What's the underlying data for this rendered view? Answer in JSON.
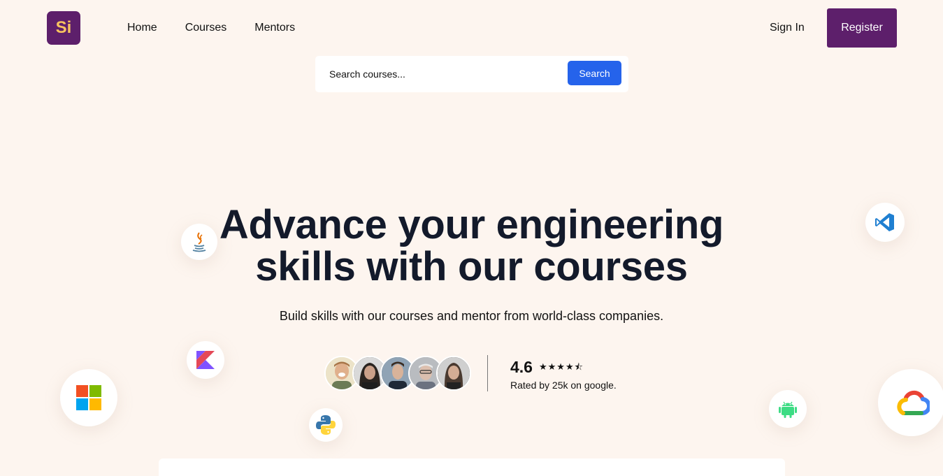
{
  "brand": {
    "logo_text": "Si",
    "logo_bg": "#5d1f6b",
    "logo_fg": "#f7c35f"
  },
  "nav": {
    "items": [
      {
        "label": "Home"
      },
      {
        "label": "Courses"
      },
      {
        "label": "Mentors"
      }
    ]
  },
  "auth": {
    "signin_label": "Sign In",
    "register_label": "Register"
  },
  "search": {
    "placeholder": "Search courses...",
    "button_label": "Search"
  },
  "hero": {
    "title_line1": "Advance your engineering",
    "title_line2": "skills with our courses",
    "subtitle": "Build skills with our courses and mentor from world-class companies."
  },
  "rating": {
    "score": "4.6",
    "stars": "★★★★⯪",
    "stars_value": 4.6,
    "caption": "Rated by 25k on google."
  },
  "avatars": [
    "avatar-1",
    "avatar-2",
    "avatar-3",
    "avatar-4",
    "avatar-5"
  ],
  "floating_icons": [
    "java-icon",
    "vscode-icon",
    "kotlin-icon",
    "windows-icon",
    "python-icon",
    "android-icon",
    "google-cloud-icon"
  ],
  "colors": {
    "background": "#fdf5ef",
    "accent": "#5d1f6b",
    "search_button": "#2563eb",
    "heading": "#131a2b"
  }
}
